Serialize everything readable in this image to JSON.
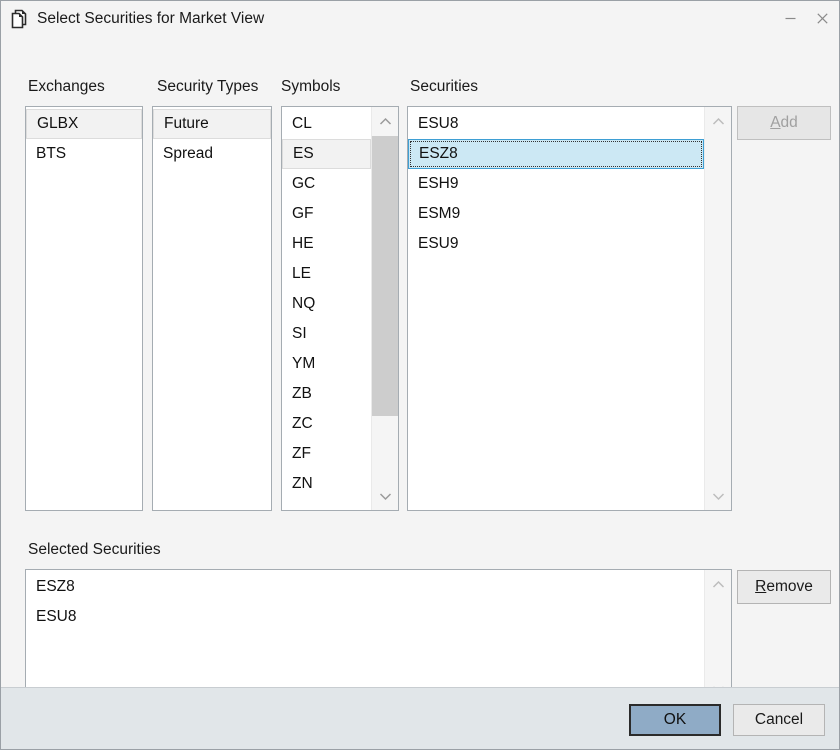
{
  "window": {
    "title": "Select Securities for Market View",
    "icon": "documents-icon",
    "minimize_label": "–",
    "close_label": "×"
  },
  "labels": {
    "exchanges": "Exchanges",
    "security_types": "Security Types",
    "symbols": "Symbols",
    "securities": "Securities",
    "selected_securities": "Selected Securities"
  },
  "exchanges": {
    "items": [
      "GLBX",
      "BTS"
    ],
    "selected": "GLBX"
  },
  "security_types": {
    "items": [
      "Future",
      "Spread"
    ],
    "selected": "Future"
  },
  "symbols": {
    "items": [
      "CL",
      "ES",
      "GC",
      "GF",
      "HE",
      "LE",
      "NQ",
      "SI",
      "YM",
      "ZB",
      "ZC",
      "ZF",
      "ZN"
    ],
    "selected": "ES",
    "clipped_next": true
  },
  "securities": {
    "items": [
      "ESU8",
      "ESZ8",
      "ESH9",
      "ESM9",
      "ESU9"
    ],
    "selected": "ESZ8"
  },
  "selected_securities": {
    "items": [
      "ESZ8",
      "ESU8"
    ]
  },
  "buttons": {
    "add": {
      "label": "Add",
      "mnemonic": "A",
      "rest": "dd",
      "enabled": false
    },
    "remove": {
      "label": "Remove",
      "mnemonic": "R",
      "rest": "emove",
      "enabled": true
    },
    "ok": {
      "label": "OK",
      "default": true
    },
    "cancel": {
      "label": "Cancel",
      "default": false
    }
  },
  "colors": {
    "accent_selection": "#cce8f4",
    "selection_border": "#3e9fd4",
    "default_button": "#8fabc6",
    "window_bg": "#f4f4f4",
    "footer_bg": "#e1e6e9",
    "scroll_thumb": "#cdcdcd"
  }
}
